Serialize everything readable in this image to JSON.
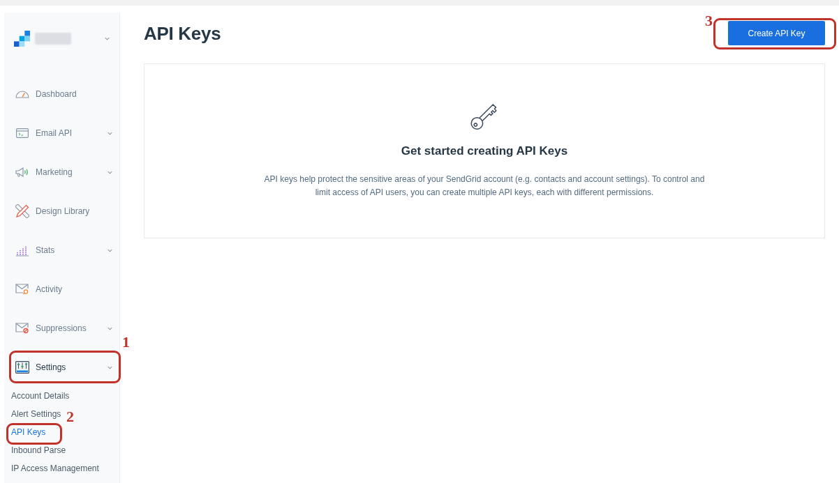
{
  "sidebar": {
    "nav_items": [
      {
        "label": "Dashboard",
        "has_submenu": false,
        "selected": false
      },
      {
        "label": "Email API",
        "has_submenu": true,
        "selected": false
      },
      {
        "label": "Marketing",
        "has_submenu": true,
        "selected": false
      },
      {
        "label": "Design Library",
        "has_submenu": false,
        "selected": false
      },
      {
        "label": "Stats",
        "has_submenu": true,
        "selected": false
      },
      {
        "label": "Activity",
        "has_submenu": false,
        "selected": false
      },
      {
        "label": "Suppressions",
        "has_submenu": true,
        "selected": false
      },
      {
        "label": "Settings",
        "has_submenu": true,
        "selected": true,
        "annotation": "1",
        "children": [
          {
            "label": "Account Details",
            "selected": false
          },
          {
            "label": "Alert Settings",
            "selected": false
          },
          {
            "label": "API Keys",
            "selected": true,
            "annotation": "2"
          },
          {
            "label": "Inbound Parse",
            "selected": false
          },
          {
            "label": "IP Access Management",
            "selected": false
          }
        ]
      }
    ]
  },
  "main": {
    "title": "API Keys",
    "create_button": {
      "label": "Create API Key",
      "annotation": "3"
    },
    "empty_state": {
      "title": "Get started creating API Keys",
      "description": "API keys help protect the sensitive areas of your SendGrid account (e.g. contacts and account settings). To control and limit access of API users, you can create multiple API keys, each with different permissions."
    }
  }
}
